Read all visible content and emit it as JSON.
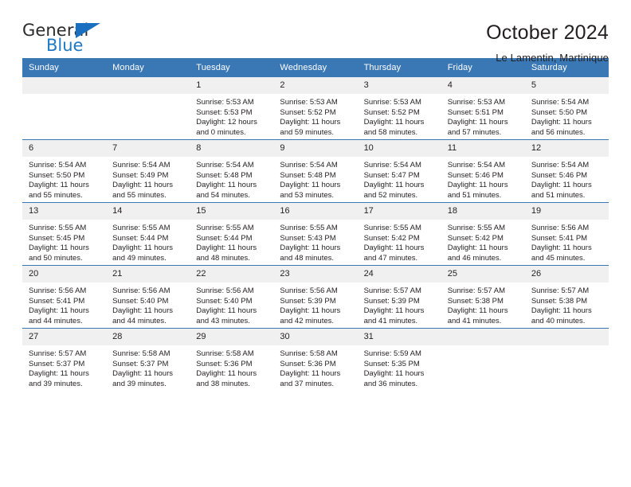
{
  "logo": {
    "line1": "General",
    "line2": "Blue",
    "triangle_icon": "blue-triangle-icon"
  },
  "header": {
    "title": "October 2024",
    "subtitle": "Le Lamentin, Martinique"
  },
  "colors": {
    "header_blue": "#3a77b5",
    "logo_blue": "#2079c4",
    "daynum_band": "#f0f0f0",
    "text": "#231f20"
  },
  "calendar": {
    "weekday_headers": [
      "Sunday",
      "Monday",
      "Tuesday",
      "Wednesday",
      "Thursday",
      "Friday",
      "Saturday"
    ],
    "weeks": [
      [
        {
          "day": "",
          "blank": true
        },
        {
          "day": "",
          "blank": true
        },
        {
          "day": "1",
          "sunrise": "Sunrise: 5:53 AM",
          "sunset": "Sunset: 5:53 PM",
          "daylight_1": "Daylight: 12 hours",
          "daylight_2": "and 0 minutes."
        },
        {
          "day": "2",
          "sunrise": "Sunrise: 5:53 AM",
          "sunset": "Sunset: 5:52 PM",
          "daylight_1": "Daylight: 11 hours",
          "daylight_2": "and 59 minutes."
        },
        {
          "day": "3",
          "sunrise": "Sunrise: 5:53 AM",
          "sunset": "Sunset: 5:52 PM",
          "daylight_1": "Daylight: 11 hours",
          "daylight_2": "and 58 minutes."
        },
        {
          "day": "4",
          "sunrise": "Sunrise: 5:53 AM",
          "sunset": "Sunset: 5:51 PM",
          "daylight_1": "Daylight: 11 hours",
          "daylight_2": "and 57 minutes."
        },
        {
          "day": "5",
          "sunrise": "Sunrise: 5:54 AM",
          "sunset": "Sunset: 5:50 PM",
          "daylight_1": "Daylight: 11 hours",
          "daylight_2": "and 56 minutes."
        }
      ],
      [
        {
          "day": "6",
          "sunrise": "Sunrise: 5:54 AM",
          "sunset": "Sunset: 5:50 PM",
          "daylight_1": "Daylight: 11 hours",
          "daylight_2": "and 55 minutes."
        },
        {
          "day": "7",
          "sunrise": "Sunrise: 5:54 AM",
          "sunset": "Sunset: 5:49 PM",
          "daylight_1": "Daylight: 11 hours",
          "daylight_2": "and 55 minutes."
        },
        {
          "day": "8",
          "sunrise": "Sunrise: 5:54 AM",
          "sunset": "Sunset: 5:48 PM",
          "daylight_1": "Daylight: 11 hours",
          "daylight_2": "and 54 minutes."
        },
        {
          "day": "9",
          "sunrise": "Sunrise: 5:54 AM",
          "sunset": "Sunset: 5:48 PM",
          "daylight_1": "Daylight: 11 hours",
          "daylight_2": "and 53 minutes."
        },
        {
          "day": "10",
          "sunrise": "Sunrise: 5:54 AM",
          "sunset": "Sunset: 5:47 PM",
          "daylight_1": "Daylight: 11 hours",
          "daylight_2": "and 52 minutes."
        },
        {
          "day": "11",
          "sunrise": "Sunrise: 5:54 AM",
          "sunset": "Sunset: 5:46 PM",
          "daylight_1": "Daylight: 11 hours",
          "daylight_2": "and 51 minutes."
        },
        {
          "day": "12",
          "sunrise": "Sunrise: 5:54 AM",
          "sunset": "Sunset: 5:46 PM",
          "daylight_1": "Daylight: 11 hours",
          "daylight_2": "and 51 minutes."
        }
      ],
      [
        {
          "day": "13",
          "sunrise": "Sunrise: 5:55 AM",
          "sunset": "Sunset: 5:45 PM",
          "daylight_1": "Daylight: 11 hours",
          "daylight_2": "and 50 minutes."
        },
        {
          "day": "14",
          "sunrise": "Sunrise: 5:55 AM",
          "sunset": "Sunset: 5:44 PM",
          "daylight_1": "Daylight: 11 hours",
          "daylight_2": "and 49 minutes."
        },
        {
          "day": "15",
          "sunrise": "Sunrise: 5:55 AM",
          "sunset": "Sunset: 5:44 PM",
          "daylight_1": "Daylight: 11 hours",
          "daylight_2": "and 48 minutes."
        },
        {
          "day": "16",
          "sunrise": "Sunrise: 5:55 AM",
          "sunset": "Sunset: 5:43 PM",
          "daylight_1": "Daylight: 11 hours",
          "daylight_2": "and 48 minutes."
        },
        {
          "day": "17",
          "sunrise": "Sunrise: 5:55 AM",
          "sunset": "Sunset: 5:42 PM",
          "daylight_1": "Daylight: 11 hours",
          "daylight_2": "and 47 minutes."
        },
        {
          "day": "18",
          "sunrise": "Sunrise: 5:55 AM",
          "sunset": "Sunset: 5:42 PM",
          "daylight_1": "Daylight: 11 hours",
          "daylight_2": "and 46 minutes."
        },
        {
          "day": "19",
          "sunrise": "Sunrise: 5:56 AM",
          "sunset": "Sunset: 5:41 PM",
          "daylight_1": "Daylight: 11 hours",
          "daylight_2": "and 45 minutes."
        }
      ],
      [
        {
          "day": "20",
          "sunrise": "Sunrise: 5:56 AM",
          "sunset": "Sunset: 5:41 PM",
          "daylight_1": "Daylight: 11 hours",
          "daylight_2": "and 44 minutes."
        },
        {
          "day": "21",
          "sunrise": "Sunrise: 5:56 AM",
          "sunset": "Sunset: 5:40 PM",
          "daylight_1": "Daylight: 11 hours",
          "daylight_2": "and 44 minutes."
        },
        {
          "day": "22",
          "sunrise": "Sunrise: 5:56 AM",
          "sunset": "Sunset: 5:40 PM",
          "daylight_1": "Daylight: 11 hours",
          "daylight_2": "and 43 minutes."
        },
        {
          "day": "23",
          "sunrise": "Sunrise: 5:56 AM",
          "sunset": "Sunset: 5:39 PM",
          "daylight_1": "Daylight: 11 hours",
          "daylight_2": "and 42 minutes."
        },
        {
          "day": "24",
          "sunrise": "Sunrise: 5:57 AM",
          "sunset": "Sunset: 5:39 PM",
          "daylight_1": "Daylight: 11 hours",
          "daylight_2": "and 41 minutes."
        },
        {
          "day": "25",
          "sunrise": "Sunrise: 5:57 AM",
          "sunset": "Sunset: 5:38 PM",
          "daylight_1": "Daylight: 11 hours",
          "daylight_2": "and 41 minutes."
        },
        {
          "day": "26",
          "sunrise": "Sunrise: 5:57 AM",
          "sunset": "Sunset: 5:38 PM",
          "daylight_1": "Daylight: 11 hours",
          "daylight_2": "and 40 minutes."
        }
      ],
      [
        {
          "day": "27",
          "sunrise": "Sunrise: 5:57 AM",
          "sunset": "Sunset: 5:37 PM",
          "daylight_1": "Daylight: 11 hours",
          "daylight_2": "and 39 minutes."
        },
        {
          "day": "28",
          "sunrise": "Sunrise: 5:58 AM",
          "sunset": "Sunset: 5:37 PM",
          "daylight_1": "Daylight: 11 hours",
          "daylight_2": "and 39 minutes."
        },
        {
          "day": "29",
          "sunrise": "Sunrise: 5:58 AM",
          "sunset": "Sunset: 5:36 PM",
          "daylight_1": "Daylight: 11 hours",
          "daylight_2": "and 38 minutes."
        },
        {
          "day": "30",
          "sunrise": "Sunrise: 5:58 AM",
          "sunset": "Sunset: 5:36 PM",
          "daylight_1": "Daylight: 11 hours",
          "daylight_2": "and 37 minutes."
        },
        {
          "day": "31",
          "sunrise": "Sunrise: 5:59 AM",
          "sunset": "Sunset: 5:35 PM",
          "daylight_1": "Daylight: 11 hours",
          "daylight_2": "and 36 minutes."
        },
        {
          "day": "",
          "blank": true
        },
        {
          "day": "",
          "blank": true
        }
      ]
    ]
  }
}
